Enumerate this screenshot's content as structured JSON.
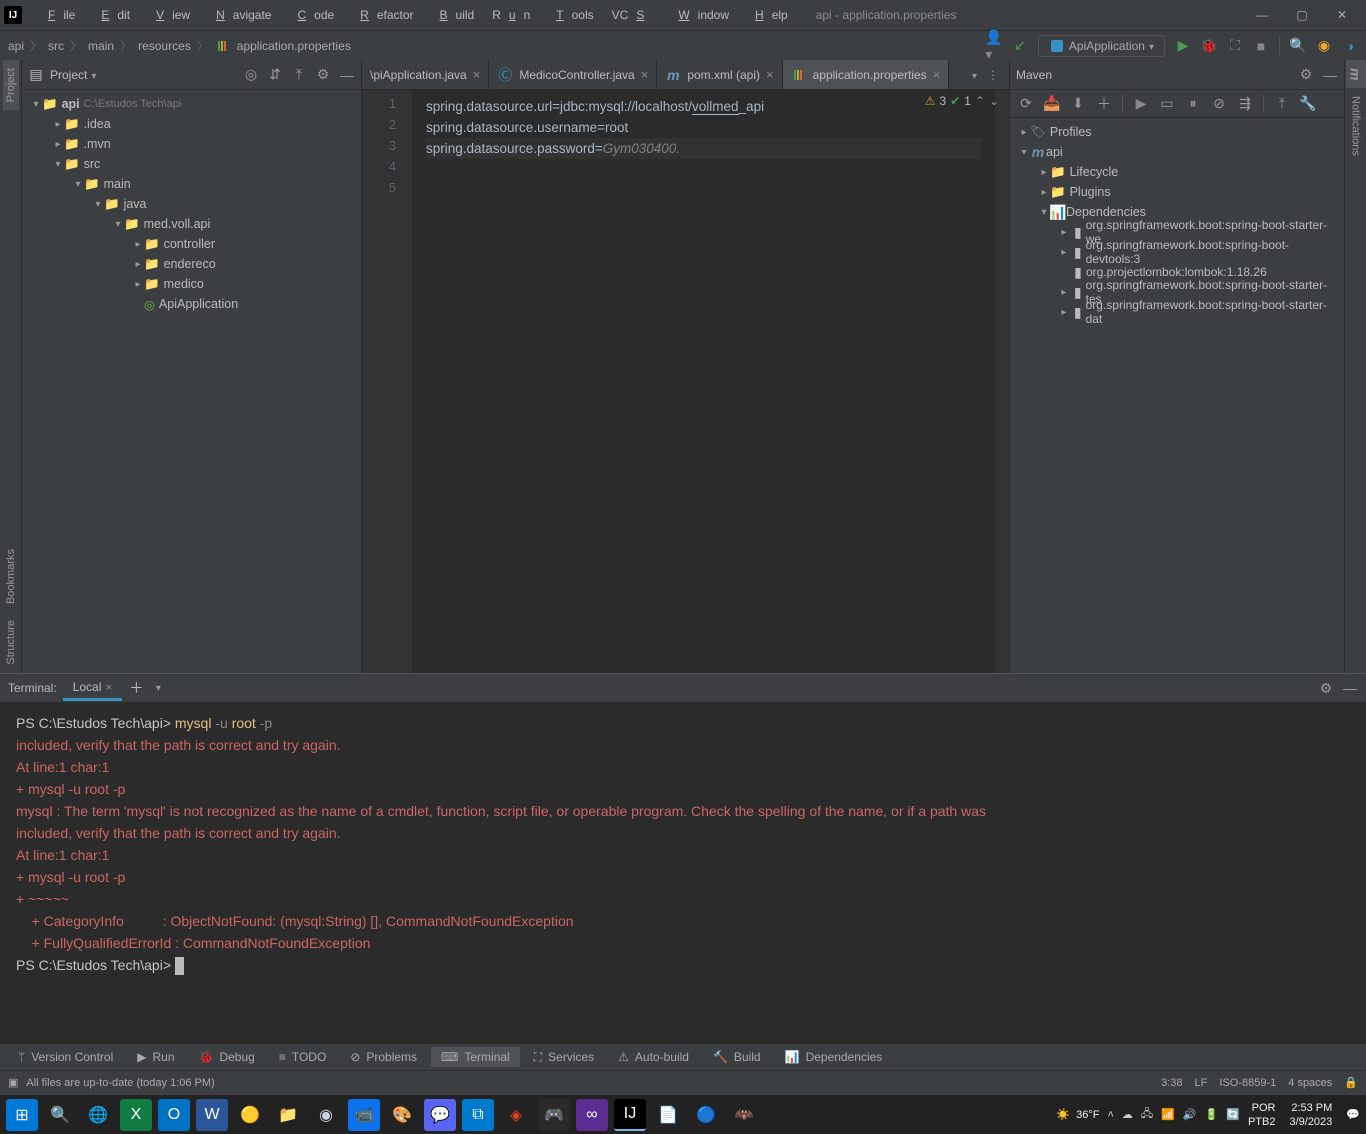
{
  "window": {
    "title": "api - application.properties",
    "menu": [
      "File",
      "Edit",
      "View",
      "Navigate",
      "Code",
      "Refactor",
      "Build",
      "Run",
      "Tools",
      "VCS",
      "Window",
      "Help"
    ]
  },
  "breadcrumbs": [
    "api",
    "src",
    "main",
    "resources",
    "application.properties"
  ],
  "run_config": "ApiApplication",
  "project": {
    "title": "Project",
    "root": {
      "name": "api",
      "path": "C:\\Estudos Tech\\api"
    },
    "tree": {
      "idea": ".idea",
      "mvn": ".mvn",
      "src": "src",
      "main": "main",
      "java": "java",
      "pkg": "med.voll.api",
      "controller": "controller",
      "endereco": "endereco",
      "medico": "medico",
      "app": "ApiApplication"
    }
  },
  "tabs": [
    {
      "label": "\\piApplication.java",
      "kind": "java"
    },
    {
      "label": "MedicoController.java",
      "kind": "java"
    },
    {
      "label": "pom.xml (api)",
      "kind": "maven"
    },
    {
      "label": "application.properties",
      "kind": "props",
      "active": true
    }
  ],
  "editor": {
    "lines": [
      {
        "n": 1,
        "left": "spring.datasource.url=",
        "mid": "jdbc:mysql://localhost/",
        "u": "vollmed",
        "tail": "_api"
      },
      {
        "n": 2,
        "text": "spring.datasource.username=root"
      },
      {
        "n": 3,
        "left": "spring.datasource.password=",
        "pwd": "Gym030400."
      },
      {
        "n": 4,
        "text": ""
      },
      {
        "n": 5,
        "text": ""
      }
    ],
    "inspections": {
      "warn": "3",
      "ok": "1"
    }
  },
  "maven": {
    "title": "Maven",
    "profiles": "Profiles",
    "module": "api",
    "lifecycle": "Lifecycle",
    "plugins": "Plugins",
    "dependencies": "Dependencies",
    "deps": [
      "org.springframework.boot:spring-boot-starter-we",
      "org.springframework.boot:spring-boot-devtools:3",
      "org.projectlombok:lombok:1.18.26",
      "org.springframework.boot:spring-boot-starter-tes",
      "org.springframework.boot:spring-boot-starter-dat"
    ]
  },
  "terminal": {
    "label": "Terminal:",
    "tab": "Local",
    "lines": [
      {
        "cls": "prompt",
        "parts": [
          {
            "c": "t-white",
            "t": "PS C:\\Estudos Tech\\api> "
          },
          {
            "c": "t-yellow",
            "t": "mysql "
          },
          {
            "c": "t-grey",
            "t": "-u "
          },
          {
            "c": "t-yellow",
            "t": "root "
          },
          {
            "c": "t-grey",
            "t": "-p"
          }
        ]
      },
      {
        "cls": "t-red",
        "t": "included, verify that the path is correct and try again."
      },
      {
        "cls": "t-red",
        "t": "At line:1 char:1"
      },
      {
        "cls": "t-red",
        "t": "+ mysql -u root -p"
      },
      {
        "cls": "t-red",
        "t": "mysql : The term 'mysql' is not recognized as the name of a cmdlet, function, script file, or operable program. Check the spelling of the name, or if a path was"
      },
      {
        "cls": "t-red",
        "t": "included, verify that the path is correct and try again."
      },
      {
        "cls": "t-red",
        "t": "At line:1 char:1"
      },
      {
        "cls": "t-red",
        "t": "+ mysql -u root -p"
      },
      {
        "cls": "t-red",
        "t": "+ ~~~~~"
      },
      {
        "cls": "t-red",
        "t": "    + CategoryInfo          : ObjectNotFound: (mysql:String) [], CommandNotFoundException"
      },
      {
        "cls": "t-red",
        "t": "    + FullyQualifiedErrorId : CommandNotFoundException"
      },
      {
        "cls": "t-white",
        "t": ""
      },
      {
        "cls": "prompt2",
        "parts": [
          {
            "c": "t-white",
            "t": "PS C:\\Estudos Tech\\api> "
          }
        ]
      }
    ]
  },
  "bottom_tools": [
    {
      "label": "Version Control",
      "icon": "branch"
    },
    {
      "label": "Run",
      "icon": "play"
    },
    {
      "label": "Debug",
      "icon": "bug"
    },
    {
      "label": "TODO",
      "icon": "todo"
    },
    {
      "label": "Problems",
      "icon": "problems"
    },
    {
      "label": "Terminal",
      "icon": "terminal",
      "active": true
    },
    {
      "label": "Services",
      "icon": "services"
    },
    {
      "label": "Auto-build",
      "icon": "autobuild"
    },
    {
      "label": "Build",
      "icon": "hammer"
    },
    {
      "label": "Dependencies",
      "icon": "deps"
    }
  ],
  "status": {
    "msg": "All files are up-to-date (today 1:06 PM)",
    "pos": "3:38",
    "sep": "LF",
    "enc": "ISO-8859-1",
    "indent": "4 spaces"
  },
  "taskbar": {
    "weather": "36°F",
    "lang_top": "POR",
    "lang_bot": "PTB2",
    "time": "2:53 PM",
    "date": "3/9/2023"
  }
}
